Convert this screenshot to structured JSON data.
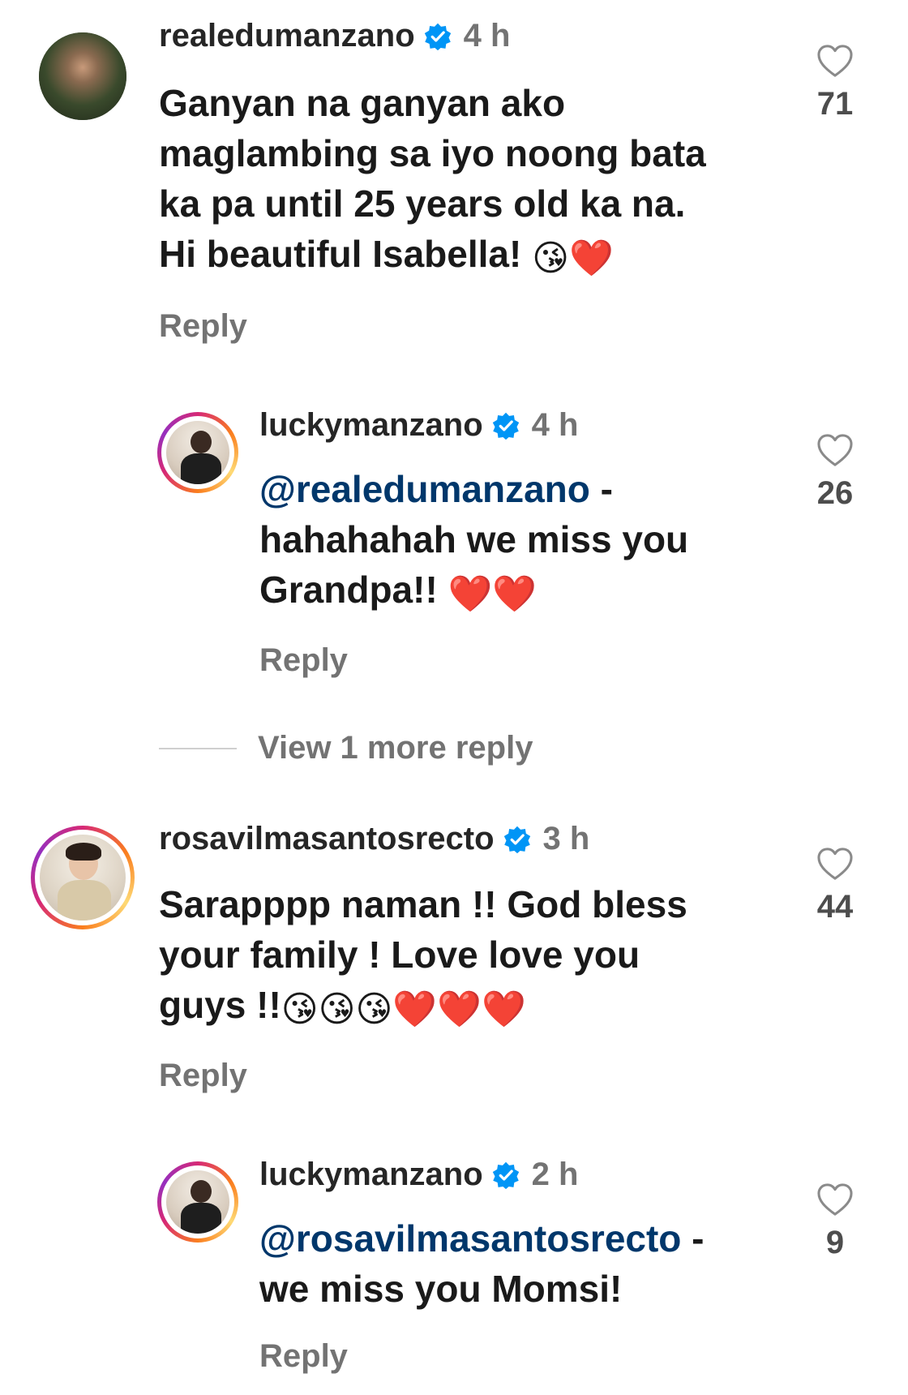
{
  "colors": {
    "text": "#1a1a1a",
    "secondary": "#737373",
    "mention": "#00376b",
    "verified_badge": "#0095f6",
    "story_ring": [
      "#d62976",
      "#fa7e1e",
      "#feda75",
      "#962fbf"
    ]
  },
  "comments": [
    {
      "username": "realedumanzano",
      "verified": true,
      "time": "4 h",
      "lines": [
        "Ganyan na ganyan ako",
        "maglambing sa iyo noong bata",
        "ka pa until 25 years old ka na.",
        "Hi beautiful Isabella!"
      ],
      "emojis_line4": "😘❤️",
      "likes": "71",
      "reply_label": "Reply"
    },
    {
      "username": "luckymanzano",
      "verified": true,
      "time": "4 h",
      "mention": "@realedumanzano",
      "lines": [
        " -",
        "hahahahah we miss you",
        "Grandpa!!"
      ],
      "emojis_line3": "❤️❤️",
      "likes": "26",
      "reply_label": "Reply"
    },
    {
      "username": "rosavilmasantosrecto",
      "verified": true,
      "time": "3 h",
      "lines": [
        "Sarapppp naman !! God bless",
        "your family ! Love love you",
        "guys !!"
      ],
      "emojis_line3": "😘😘😘❤️❤️❤️",
      "likes": "44",
      "reply_label": "Reply"
    },
    {
      "username": "luckymanzano",
      "verified": true,
      "time": "2 h",
      "mention": "@rosavilmasantosrecto",
      "lines": [
        " -",
        "we miss you Momsi!"
      ],
      "likes": "9",
      "reply_label": "Reply"
    }
  ],
  "view_more": "View 1 more reply",
  "icons": {
    "like": "heart-outline-icon",
    "verified": "verified-badge-icon"
  }
}
